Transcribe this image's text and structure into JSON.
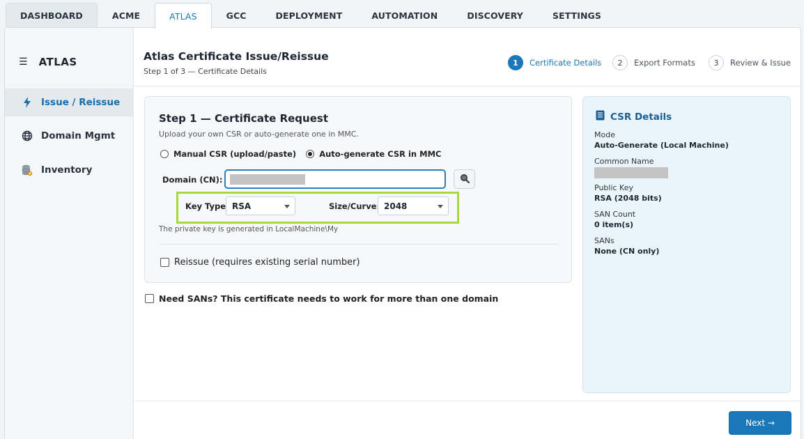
{
  "top_tabs": [
    {
      "label": "DASHBOARD"
    },
    {
      "label": "ACME"
    },
    {
      "label": "ATLAS",
      "active": true
    },
    {
      "label": "GCC"
    },
    {
      "label": "DEPLOYMENT"
    },
    {
      "label": "AUTOMATION"
    },
    {
      "label": "DISCOVERY"
    },
    {
      "label": "SETTINGS"
    }
  ],
  "sidebar": {
    "title": "ATLAS",
    "menu_icon": "hamburger-icon",
    "items": [
      {
        "label": "Issue / Reissue",
        "icon": "lightning-icon",
        "active": true
      },
      {
        "label": "Domain Mgmt",
        "icon": "globe-icon"
      },
      {
        "label": "Inventory",
        "icon": "database-icon"
      }
    ]
  },
  "header": {
    "title": "Atlas Certificate Issue/Reissue",
    "subtitle": "Step 1 of 3 — Certificate Details",
    "steps": [
      {
        "number": "1",
        "label": "Certificate Details",
        "active": true
      },
      {
        "number": "2",
        "label": "Export Formats"
      },
      {
        "number": "3",
        "label": "Review & Issue"
      }
    ]
  },
  "request_card": {
    "title": "Step 1 — Certificate Request",
    "subtitle": "Upload your own CSR or auto-generate one in MMC.",
    "radio_options": [
      {
        "label": "Manual CSR (upload/paste)",
        "selected": false
      },
      {
        "label": "Auto-generate CSR in MMC",
        "selected": true
      }
    ],
    "domain_label": "Domain (CN):",
    "domain_value": "",
    "lookup_icon": "magnifier-icon",
    "key_type_label": "Key Type:",
    "key_type_value": "RSA",
    "size_label": "Size/Curve:",
    "size_value": "2048",
    "hint": "The private key is generated in LocalMachine\\My",
    "reissue_label": "Reissue (requires existing serial number)"
  },
  "sans_checkbox_label": "Need SANs? This certificate needs to work for more than one domain",
  "csr_panel": {
    "title": "CSR Details",
    "icon": "document-icon",
    "fields": [
      {
        "key": "Mode",
        "value": "Auto-Generate (Local Machine)"
      },
      {
        "key": "Common Name",
        "value": ""
      },
      {
        "key": "Public Key",
        "value": "RSA (2048 bits)"
      },
      {
        "key": "SAN Count",
        "value": "0 item(s)"
      },
      {
        "key": "SANs",
        "value": "None (CN only)"
      }
    ]
  },
  "footer": {
    "next_label": "Next →"
  },
  "colors": {
    "accent": "#1a78b8",
    "highlight": "#a6d93c",
    "panel_bg": "#eaf5fb"
  }
}
